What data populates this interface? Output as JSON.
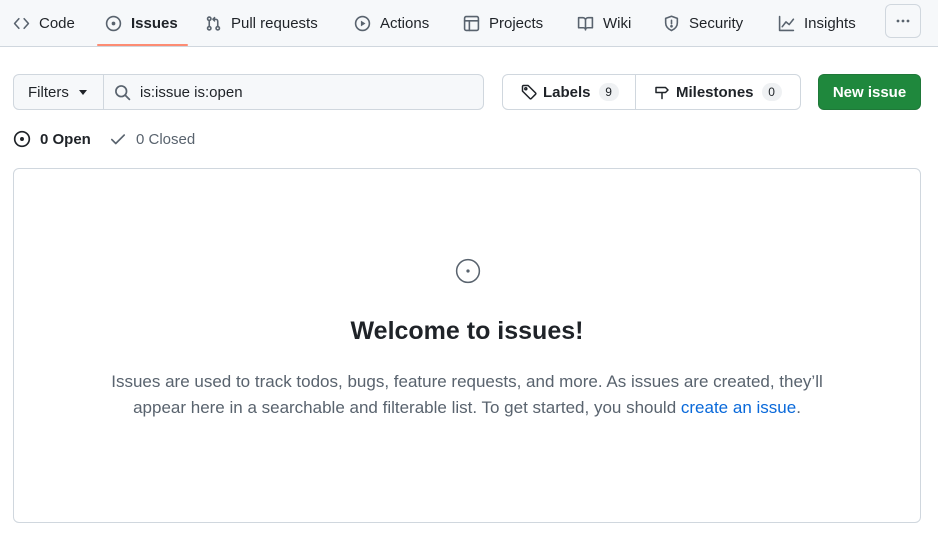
{
  "nav": {
    "items": [
      {
        "label": "Code",
        "icon": "code-icon"
      },
      {
        "label": "Issues",
        "icon": "issue-opened-icon"
      },
      {
        "label": "Pull requests",
        "icon": "git-pull-request-icon"
      },
      {
        "label": "Actions",
        "icon": "play-icon"
      },
      {
        "label": "Projects",
        "icon": "table-icon"
      },
      {
        "label": "Wiki",
        "icon": "book-icon"
      },
      {
        "label": "Security",
        "icon": "shield-icon"
      },
      {
        "label": "Insights",
        "icon": "graph-icon"
      }
    ],
    "selected": "Issues",
    "more_icon": "kebab-horizontal-icon"
  },
  "toolbar": {
    "filters_label": "Filters",
    "search_value": "is:issue is:open",
    "labels_label": "Labels",
    "labels_count": "9",
    "milestones_label": "Milestones",
    "milestones_count": "0",
    "new_issue_label": "New issue"
  },
  "states": {
    "open_label": "0 Open",
    "closed_label": "0 Closed"
  },
  "blankslate": {
    "title": "Welcome to issues!",
    "text_before_link": "Issues are used to track todos, bugs, feature requests, and more. As issues are created, they’ll appear here in a searchable and filterable list. To get started, you should ",
    "link_text": "create an issue",
    "text_after_link": "."
  },
  "colors": {
    "primary_button": "#1f883d",
    "selected_tab_underline": "#fd8c73",
    "link": "#0969da"
  }
}
